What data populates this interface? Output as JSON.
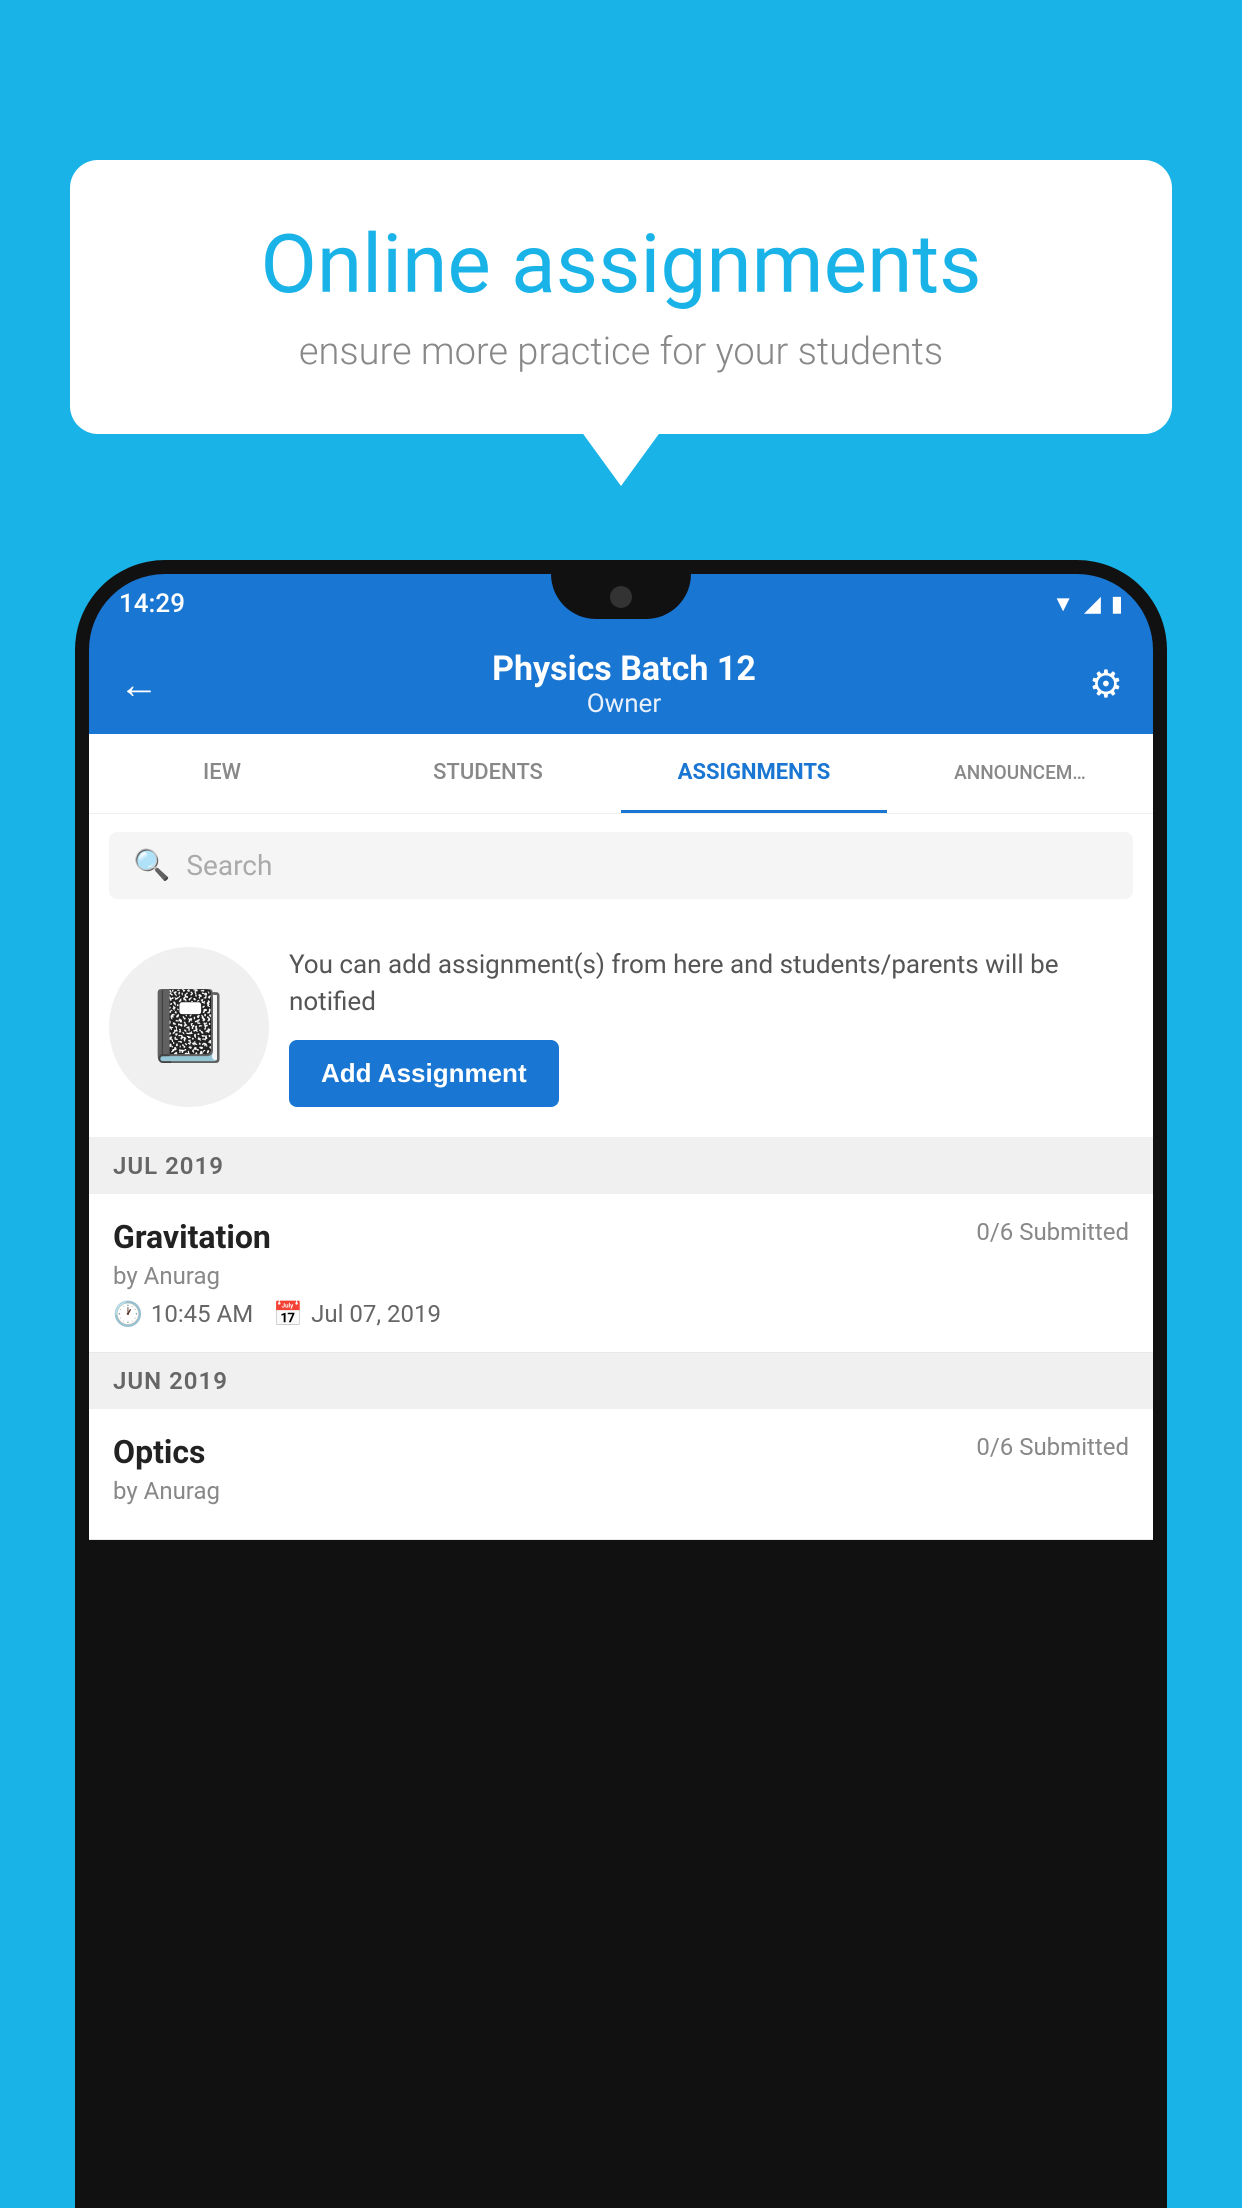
{
  "background": {
    "color": "#1ab3e8"
  },
  "speech_bubble": {
    "title": "Online assignments",
    "subtitle": "ensure more practice for your students"
  },
  "status_bar": {
    "time": "14:29",
    "color": "#1976d2"
  },
  "app_header": {
    "title": "Physics Batch 12",
    "subtitle": "Owner",
    "back_label": "←",
    "settings_label": "⚙"
  },
  "tabs": [
    {
      "label": "IEW",
      "active": false
    },
    {
      "label": "STUDENTS",
      "active": false
    },
    {
      "label": "ASSIGNMENTS",
      "active": true
    },
    {
      "label": "ANNOUNCEM…",
      "active": false
    }
  ],
  "search": {
    "placeholder": "Search"
  },
  "promo": {
    "description": "You can add assignment(s) from here and students/parents will be notified",
    "button_label": "Add Assignment"
  },
  "sections": [
    {
      "month": "JUL 2019",
      "assignments": [
        {
          "name": "Gravitation",
          "submitted": "0/6 Submitted",
          "author": "by Anurag",
          "time": "10:45 AM",
          "date": "Jul 07, 2019"
        }
      ]
    },
    {
      "month": "JUN 2019",
      "assignments": [
        {
          "name": "Optics",
          "submitted": "0/6 Submitted",
          "author": "by Anurag",
          "time": "",
          "date": ""
        }
      ]
    }
  ]
}
